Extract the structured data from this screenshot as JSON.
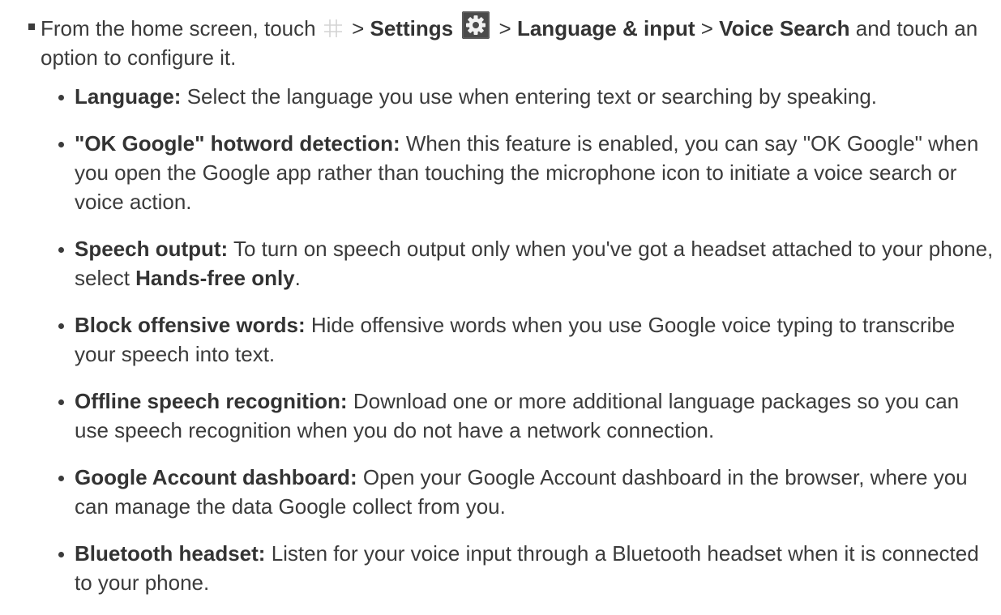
{
  "intro": {
    "prefix": "From the home screen, touch",
    "sep1": ">",
    "settings": "Settings",
    "sep2": ">",
    "language_input": "Language & input",
    "sep3": ">",
    "voice_search": "Voice Search",
    "suffix": "and touch an option to configure it."
  },
  "options": [
    {
      "term": "Language:",
      "desc": "Select the language you use when entering text or searching by speaking."
    },
    {
      "term": "\"OK Google\" hotword detection:",
      "desc": "When this feature is enabled, you can say \"OK Google\" when you open the Google app rather than touching the microphone icon to initiate a voice search or voice action."
    },
    {
      "term": "Speech output:",
      "desc": "To turn on speech output only when you've got a headset attached to your phone, select",
      "emphasis": "Hands-free only",
      "end": "."
    },
    {
      "term": "Block offensive words:",
      "desc": "Hide offensive words when you use Google voice typing to transcribe your speech into text."
    },
    {
      "term": "Offline speech recognition:",
      "desc": "Download one or more additional language packages so you can use speech recognition when you do not have a network connection."
    },
    {
      "term": "Google Account dashboard:",
      "desc": "Open your Google Account dashboard in the browser, where you can manage the data Google collect from you."
    },
    {
      "term": "Bluetooth headset:",
      "desc": "Listen for your voice input through a Bluetooth headset when it is connected to your phone."
    }
  ]
}
